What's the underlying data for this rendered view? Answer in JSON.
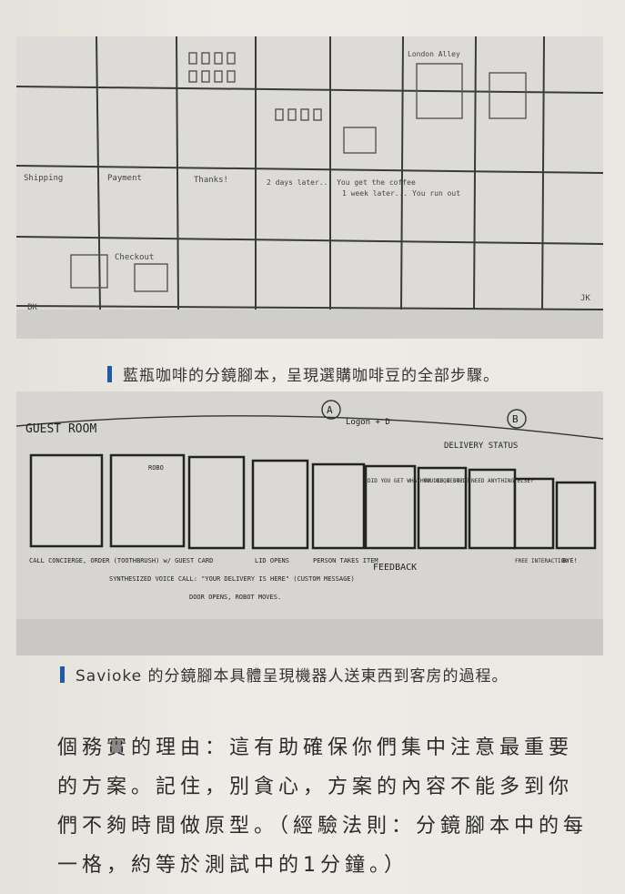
{
  "photo1": {
    "sketch_text": [
      "Thanks!",
      "Checkout",
      "Shipping",
      "Payment",
      "2 days later... You get the coffee",
      "1 week later... You run out",
      "BK",
      "JK",
      "London Alley"
    ]
  },
  "caption1": "藍瓶咖啡的分鏡腳本，呈現選購咖啡豆的全部步驟。",
  "photo2": {
    "header": "GUEST ROOM",
    "circle_a": "A",
    "circle_b": "B",
    "logon": "Logon + D",
    "delivery_status": "DELIVERY STATUS",
    "feedback": "FEEDBACK",
    "panels": [
      {
        "caption": "CALL CONCIERGE, ORDER (TOOTHBRUSH) w/ GUEST CARD"
      },
      {
        "caption": "SYNTHESIZED VOICE CALL: \"YOUR DELIVERY IS HERE\" (CUSTOM MESSAGE)",
        "inner": "ROBO"
      },
      {
        "caption": "DOOR OPENS, ROBOT MOVES."
      },
      {
        "caption": "LID OPENS"
      },
      {
        "caption": "PERSON TAKES ITEM"
      },
      {
        "inner": "DID YOU GET WHAT YOU REQUESTED?"
      },
      {
        "inner": "HOW DID I DO?"
      },
      {
        "inner": "NEED ANYTHING ELSE?"
      },
      {
        "caption": "FREE INTERACTION"
      },
      {
        "caption": "BYE!"
      }
    ]
  },
  "caption2": "Savioke 的分鏡腳本具體呈現機器人送東西到客房的過程。",
  "body_paragraph": "個務實的理由：這有助確保你們集中注意最重要的方案。記住，別貪心，方案的內容不能多到你們不夠時間做原型。（經驗法則：分鏡腳本中的每一格，約等於測試中的1分鐘。）"
}
